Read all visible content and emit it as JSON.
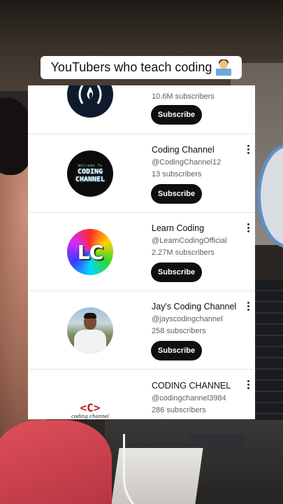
{
  "caption": {
    "text": "YouTubers who teach coding",
    "emoji": "technologist-emoji"
  },
  "channels": [
    {
      "name": "",
      "handle": "",
      "subscribers": "10.6M subscribers",
      "button": "Subscribe",
      "avatar": "freecodecamp-logo"
    },
    {
      "name": "Coding Channel",
      "handle": "@CodingChannel12",
      "subscribers": "13 subscribers",
      "button": "Subscribe",
      "avatar": "coding-channel-logo",
      "avatar_small": "Welcome To",
      "avatar_line1": "CODING",
      "avatar_line2": "CHANNEL"
    },
    {
      "name": "Learn Coding",
      "handle": "@LearnCodingOfficial",
      "subscribers": "2.27M subscribers",
      "button": "Subscribe",
      "avatar": "learn-coding-logo",
      "avatar_text": "LC"
    },
    {
      "name": "Jay's Coding Channel",
      "handle": "@jayscodingchannel",
      "subscribers": "258 subscribers",
      "button": "Subscribe",
      "avatar": "person-photo"
    },
    {
      "name": "CODING CHANNEL",
      "handle": "@codingchannel3984",
      "subscribers": "286 subscribers",
      "button": "Subscribe",
      "avatar": "coding-channel-red-logo",
      "avatar_logo": "<C>",
      "avatar_label": "coding channel"
    }
  ],
  "colors": {
    "button_bg": "#0f0f0f",
    "button_text": "#ffffff",
    "secondary_text": "#606060",
    "panel_bg": "#ffffff"
  }
}
